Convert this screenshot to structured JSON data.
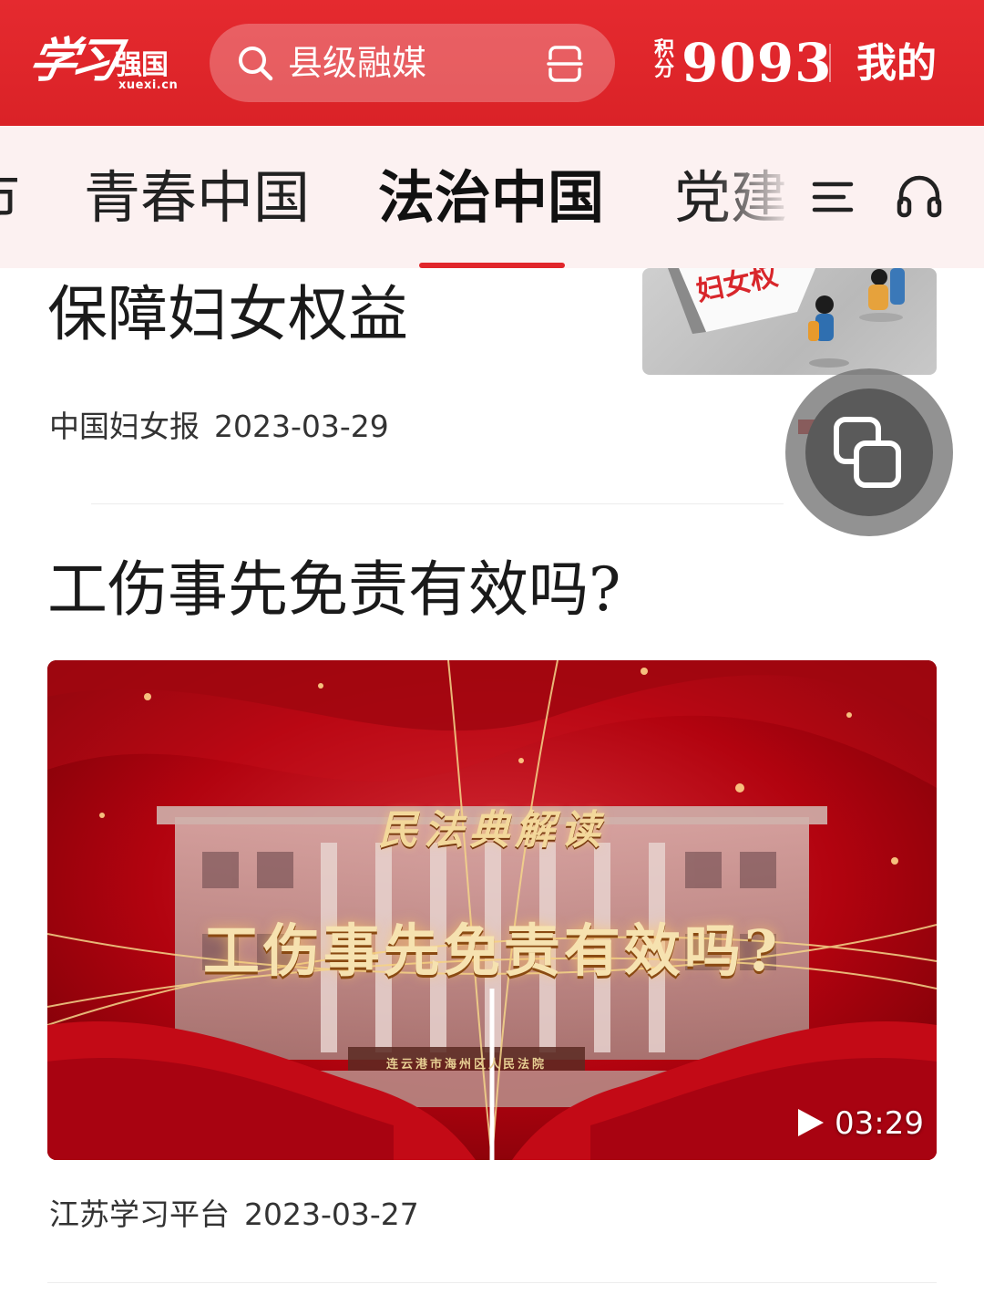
{
  "header": {
    "logo_brush_text": "学习",
    "logo_text": "强国",
    "logo_domain": "xuexi.cn",
    "search_placeholder": "县级融媒",
    "points_label": "积分",
    "points_value": "9093",
    "mine_label": "我的",
    "colors": {
      "brand_red": "#e1262b"
    }
  },
  "tabs": {
    "items": [
      {
        "label": "市",
        "active": false
      },
      {
        "label": "青春中国",
        "active": false
      },
      {
        "label": "法治中国",
        "active": true
      },
      {
        "label": "党建",
        "active": false
      }
    ],
    "icons": [
      "menu-icon",
      "headphones-icon"
    ]
  },
  "articles": [
    {
      "title": "保障妇女权益",
      "source": "中国妇女报",
      "date": "2023-03-29",
      "thumbnail_text": "妇女权"
    },
    {
      "title": "工伤事先免责有效吗?",
      "video": {
        "overlay_title": "民法典解读",
        "overlay_main": "工伤事先免责有效吗?",
        "court_sign": "连云港市海州区人民法院",
        "duration": "03:29"
      },
      "source": "江苏学习平台",
      "date": "2023-03-27"
    }
  ],
  "floating_button": {
    "icon": "multi-window-icon"
  }
}
